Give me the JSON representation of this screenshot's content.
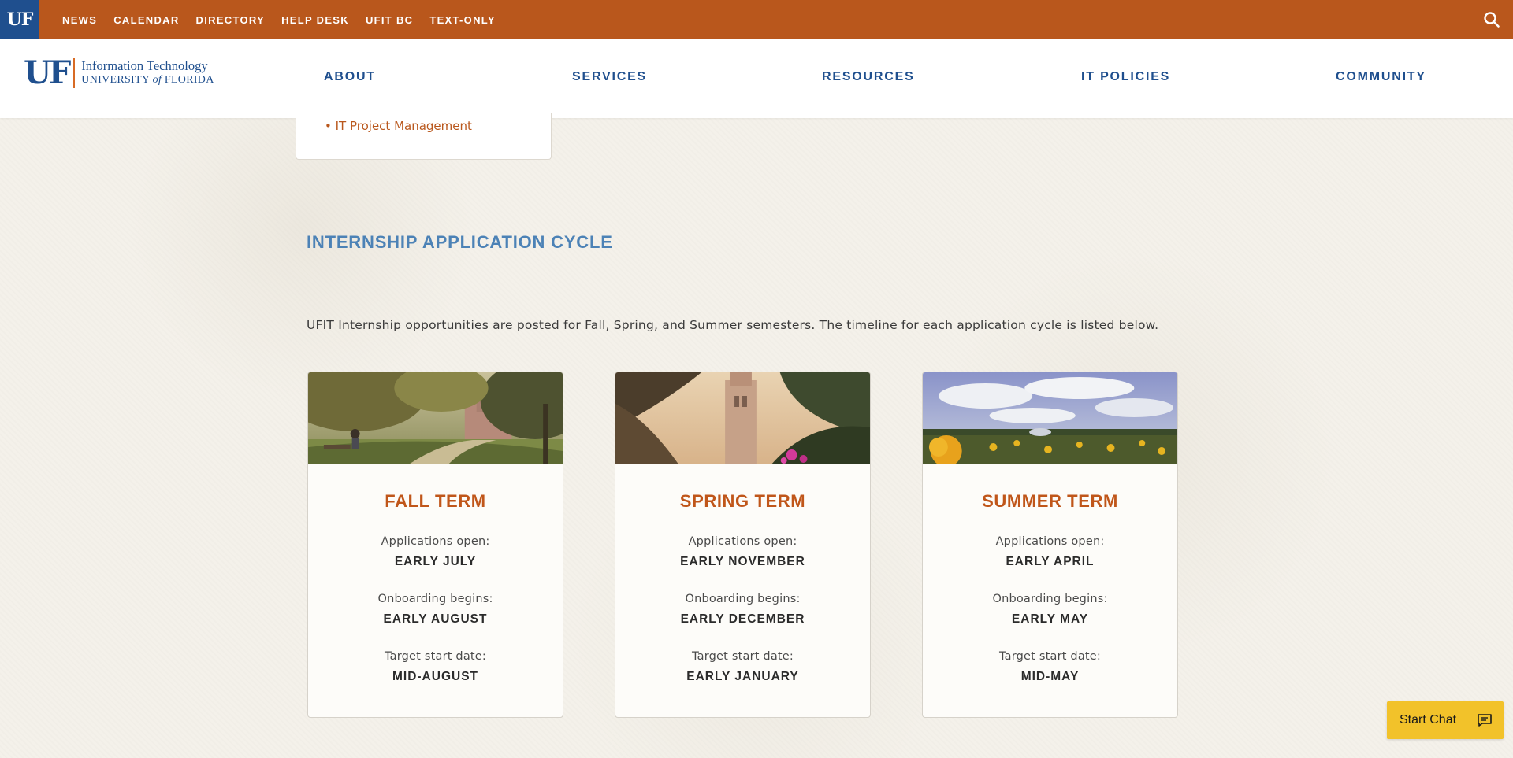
{
  "topbar": {
    "badge": "UF",
    "links": [
      "NEWS",
      "CALENDAR",
      "DIRECTORY",
      "HELP DESK",
      "UFIT BC",
      "TEXT-ONLY"
    ],
    "search_icon": "search-icon"
  },
  "header": {
    "logo_mark": "UF",
    "logo_line1": "Information Technology",
    "logo_line2_prefix": "UNIVERSITY ",
    "logo_line2_of": "of",
    "logo_line2_suffix": " FLORIDA",
    "nav": [
      "ABOUT",
      "SERVICES",
      "RESOURCES",
      "IT POLICIES",
      "COMMUNITY"
    ]
  },
  "submenu": {
    "item": "IT Project Management"
  },
  "section": {
    "title": "INTERNSHIP APPLICATION CYCLE",
    "intro": "UFIT Internship opportunities are posted for Fall, Spring, and Summer semesters. The timeline for each application cycle is listed below."
  },
  "cards": [
    {
      "title": "FALL TERM",
      "label1": "Applications open:",
      "value1": "EARLY JULY",
      "label2": "Onboarding begins:",
      "value2": "EARLY AUGUST",
      "label3": "Target start date:",
      "value3": "MID-AUGUST"
    },
    {
      "title": "SPRING TERM",
      "label1": "Applications open:",
      "value1": "EARLY NOVEMBER",
      "label2": "Onboarding begins:",
      "value2": "EARLY DECEMBER",
      "label3": "Target start date:",
      "value3": "EARLY JANUARY"
    },
    {
      "title": "SUMMER TERM",
      "label1": "Applications open:",
      "value1": "EARLY APRIL",
      "label2": "Onboarding begins:",
      "value2": "EARLY MAY",
      "label3": "Target start date:",
      "value3": "MID-MAY"
    }
  ],
  "chat": {
    "label": "Start Chat",
    "icon": "chat-icon"
  },
  "colors": {
    "topbar": "#b9571c",
    "brand_blue": "#1f4f8e",
    "section_title": "#4c82b6",
    "card_title": "#c0561a",
    "chat": "#f2c22a"
  }
}
